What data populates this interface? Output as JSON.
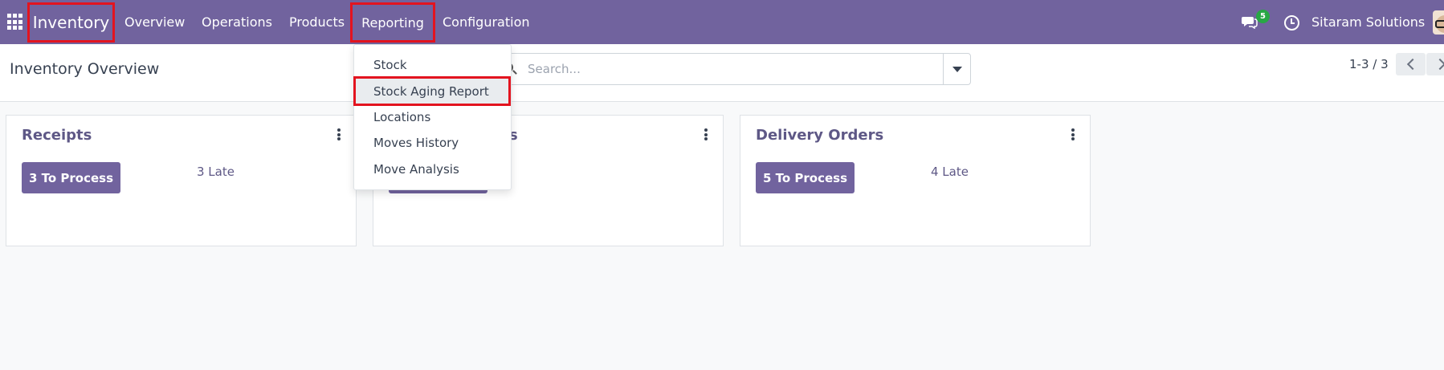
{
  "navbar": {
    "brand": "Inventory",
    "menu": [
      {
        "label": "Overview"
      },
      {
        "label": "Operations"
      },
      {
        "label": "Products"
      },
      {
        "label": "Reporting"
      },
      {
        "label": "Configuration"
      }
    ],
    "messages_badge": "5",
    "company": "Sitaram Solutions",
    "icons": [
      "apps-grid-icon",
      "chat-icon",
      "clock-icon",
      "user-avatar"
    ]
  },
  "control_panel": {
    "title": "Inventory Overview",
    "search_placeholder": "Search...",
    "pager": "1-3 / 3"
  },
  "reporting_dropdown": {
    "items": [
      {
        "label": "Stock"
      },
      {
        "label": "Stock Aging Report"
      },
      {
        "label": "Locations"
      },
      {
        "label": "Moves History"
      },
      {
        "label": "Move Analysis"
      }
    ],
    "highlighted_item": "Stock Aging Report"
  },
  "cards": [
    {
      "title": "Receipts",
      "button": "3 To Process",
      "late": "3 Late"
    },
    {
      "title": "s",
      "button": "",
      "late": ""
    },
    {
      "title": "Delivery Orders",
      "button": "5 To Process",
      "late": "4 Late"
    }
  ],
  "colors": {
    "navbar": "#71639e",
    "highlight_border": "#e3141f",
    "accent_text": "#5e5886",
    "badge": "#28a745"
  }
}
